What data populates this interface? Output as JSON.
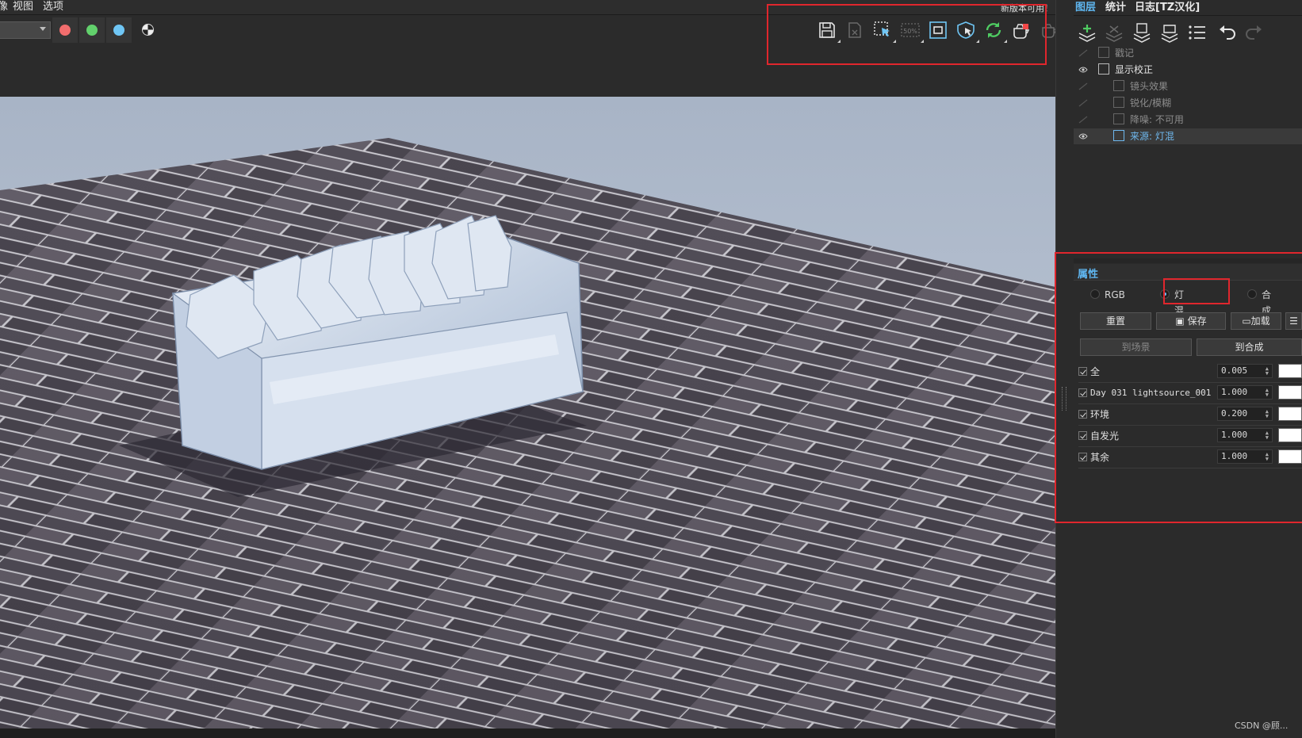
{
  "menu": {
    "items": [
      "像",
      "视图",
      "选项"
    ],
    "update_note": "新版本可用！"
  },
  "toolbar": {
    "channel_colors": [
      "#f26d6d",
      "#62d16c",
      "#6fc6f5"
    ],
    "channel_icons": [
      "red-channel-icon",
      "green-channel-icon",
      "blue-channel-icon",
      "alpha-channel-icon"
    ],
    "tools": [
      "save-icon",
      "save-all-icon",
      "region-render-icon",
      "test-resolution-icon",
      "frame-icon",
      "pick-icon",
      "refresh-icon",
      "stop-render-icon",
      "teapot-icon"
    ]
  },
  "right_panel": {
    "tabs": [
      "图层",
      "统计",
      "日志[TZ汉化]"
    ],
    "tab_colors": {
      "active": "#5fb6f0",
      "inactive": "#e8e8e8"
    },
    "layers": [
      {
        "name": "戳记",
        "visible": false,
        "indent": 0
      },
      {
        "name": "显示校正",
        "visible": true,
        "indent": 0
      },
      {
        "name": "镜头效果",
        "visible": false,
        "indent": 1
      },
      {
        "name": "锐化/模糊",
        "visible": false,
        "indent": 1
      },
      {
        "name": "降噪: 不可用",
        "visible": false,
        "indent": 1
      },
      {
        "name": "来源: 灯混",
        "visible": true,
        "indent": 1,
        "selected": true
      }
    ],
    "properties": {
      "title": "属性",
      "modes": [
        {
          "label": "RGB",
          "selected": false
        },
        {
          "label": "灯混",
          "selected": true
        },
        {
          "label": "合成",
          "selected": false
        }
      ],
      "buttons": {
        "reset": "重置",
        "save": "保存",
        "load": "加载",
        "to_scene": "到场景",
        "to_composite": "到合成"
      },
      "rows": [
        {
          "name": "全",
          "value": "0.005"
        },
        {
          "name": "Day 031 lightsource_001",
          "value": "1.000"
        },
        {
          "name": "环境",
          "value": "0.200"
        },
        {
          "name": "自发光",
          "value": "1.000"
        },
        {
          "name": "其余",
          "value": "1.000"
        }
      ]
    }
  },
  "watermark": "CSDN @顾..."
}
